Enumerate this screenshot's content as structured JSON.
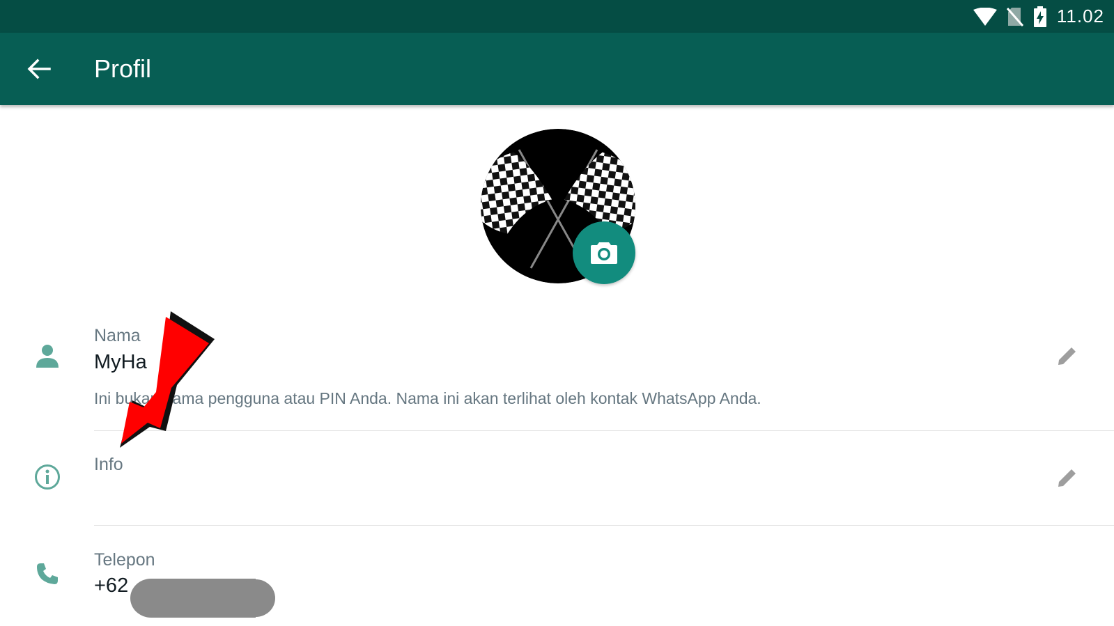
{
  "status_bar": {
    "time": "11.02",
    "icons": [
      "wifi-icon",
      "no-sim-icon",
      "battery-charging-icon"
    ]
  },
  "app_bar": {
    "back_icon": "arrow-left-icon",
    "title": "Profil"
  },
  "profile": {
    "avatar_icon": "checkered-flags-image",
    "camera_icon": "camera-icon"
  },
  "name": {
    "icon": "person-icon",
    "label": "Nama",
    "value": "MyHa",
    "hint": "Ini bukan nama pengguna atau PIN Anda. Nama ini akan terlihat oleh kontak WhatsApp Anda.",
    "edit_icon": "pencil-icon"
  },
  "about": {
    "icon": "info-icon",
    "label": "Info",
    "edit_icon": "pencil-icon"
  },
  "phone": {
    "icon": "phone-icon",
    "label": "Telepon",
    "value": "+62"
  },
  "colors": {
    "status_bar": "#054d44",
    "app_bar": "#075e54",
    "accent": "#128c7e",
    "icon_tint": "#5ea89a",
    "annotation_arrow": "#ff0000"
  }
}
